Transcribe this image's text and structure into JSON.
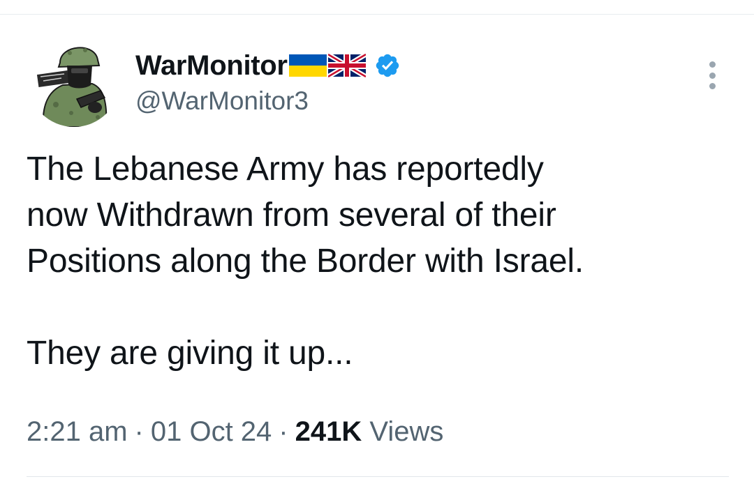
{
  "author": {
    "display_name": "WarMonitor",
    "flags": [
      "ukraine-flag-icon",
      "uk-flag-icon"
    ],
    "verified_icon": "verified-badge-icon",
    "handle": "@WarMonitor3",
    "avatar_icon": "soldier-avatar-icon"
  },
  "more_icon": "more-options-icon",
  "tweet": {
    "lines": [
      "The Lebanese Army has reportedly",
      "now Withdrawn from several of their",
      "Positions along the Border with Israel."
    ],
    "second_paragraph": "They are giving it up..."
  },
  "meta": {
    "time": "2:21 am",
    "separator": "·",
    "date": "01 Oct 24",
    "views_count": "241K",
    "views_label": "Views"
  },
  "colors": {
    "verified_blue": "#1d9bf0",
    "secondary_text": "#536471",
    "primary_text": "#0f1419",
    "ukraine_blue": "#0057b7",
    "ukraine_yellow": "#ffd700"
  }
}
